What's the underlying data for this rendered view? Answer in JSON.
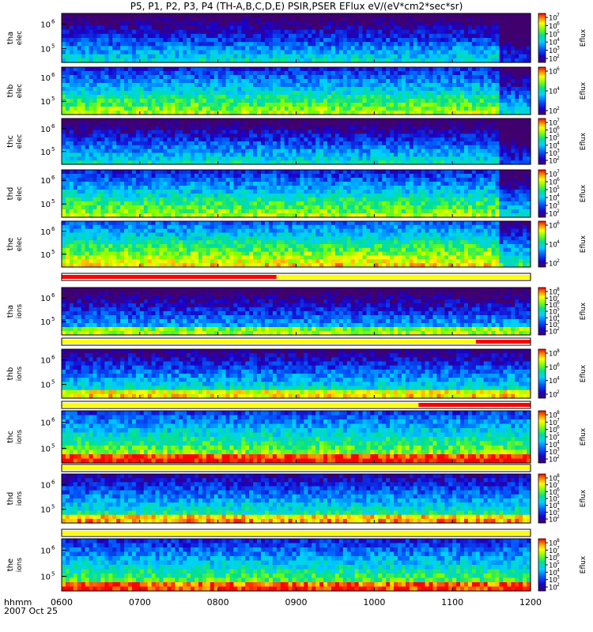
{
  "title": "P5, P1, P2, P3, P4 (TH-A,B,C,D,E) PSIR,PSER EFlux eV/(eV*cm2*sec*sr)",
  "time_axis": {
    "ticks": [
      "0600",
      "0700",
      "0800",
      "0900",
      "1000",
      "1100",
      "1200"
    ],
    "label_top": "hhmm",
    "label_bottom": "2007 Oct 25"
  },
  "colorbar_label": "Eflux",
  "chart_data": [
    {
      "type": "heatmap",
      "probe": "tha",
      "species": "elec",
      "ylabel_top": "tha",
      "ylabel_bottom": "elec",
      "y_ticks": [
        "10",
        "10"
      ],
      "y_tick_exp": [
        "6",
        "5"
      ],
      "cbar_ticks": [
        "10",
        "10",
        "10",
        "10",
        "10",
        "10"
      ],
      "cbar_exp": [
        "7",
        "6",
        "5",
        "4",
        "3",
        "2"
      ],
      "colormap": "rainbow",
      "level_fraction": 0.2
    },
    {
      "type": "heatmap",
      "probe": "thb",
      "species": "elec",
      "ylabel_top": "thb",
      "ylabel_bottom": "elec",
      "y_ticks": [
        "10",
        "10"
      ],
      "y_tick_exp": [
        "6",
        "5"
      ],
      "cbar_ticks": [
        "10",
        "10",
        "10"
      ],
      "cbar_exp": [
        "6",
        "4",
        "2"
      ],
      "colormap": "rainbow",
      "level_fraction": 0.45
    },
    {
      "type": "heatmap",
      "probe": "thc",
      "species": "elec",
      "ylabel_top": "thc",
      "ylabel_bottom": "elec",
      "y_ticks": [
        "10",
        "10"
      ],
      "y_tick_exp": [
        "6",
        "5"
      ],
      "cbar_ticks": [
        "10",
        "10",
        "10",
        "10",
        "10",
        "10"
      ],
      "cbar_exp": [
        "7",
        "6",
        "5",
        "4",
        "3",
        "2"
      ],
      "colormap": "rainbow",
      "level_fraction": 0.22
    },
    {
      "type": "heatmap",
      "probe": "thd",
      "species": "elec",
      "ylabel_top": "thd",
      "ylabel_bottom": "elec",
      "y_ticks": [
        "10",
        "10"
      ],
      "y_tick_exp": [
        "6",
        "5"
      ],
      "cbar_ticks": [
        "10",
        "10",
        "10",
        "10",
        "10",
        "10"
      ],
      "cbar_exp": [
        "7",
        "6",
        "5",
        "4",
        "3",
        "2"
      ],
      "colormap": "rainbow",
      "level_fraction": 0.45
    },
    {
      "type": "heatmap",
      "probe": "the",
      "species": "elec",
      "ylabel_top": "the",
      "ylabel_bottom": "elec",
      "y_ticks": [
        "10",
        "10"
      ],
      "y_tick_exp": [
        "6",
        "5"
      ],
      "cbar_ticks": [
        "10",
        "10",
        "10"
      ],
      "cbar_exp": [
        "6",
        "4",
        "2"
      ],
      "colormap": "rainbow",
      "level_fraction": 0.55
    },
    {
      "type": "heatmap",
      "probe": "tha",
      "species": "ions",
      "ylabel_top": "tha",
      "ylabel_bottom": "ions",
      "y_ticks": [
        "10",
        "10"
      ],
      "y_tick_exp": [
        "6",
        "5"
      ],
      "cbar_ticks": [
        "10",
        "10",
        "10",
        "10",
        "10",
        "10",
        "10"
      ],
      "cbar_exp": [
        "8",
        "7",
        "6",
        "5",
        "4",
        "3",
        "2"
      ],
      "colormap": "rainbow",
      "level_fraction": 0.2
    },
    {
      "type": "heatmap",
      "probe": "thb",
      "species": "ions",
      "ylabel_top": "thb",
      "ylabel_bottom": "ions",
      "y_ticks": [
        "10",
        "10"
      ],
      "y_tick_exp": [
        "6",
        "5"
      ],
      "cbar_ticks": [
        "10",
        "10",
        "10",
        "10"
      ],
      "cbar_exp": [
        "8",
        "6",
        "4",
        "2"
      ],
      "colormap": "rainbow",
      "level_fraction": 0.3
    },
    {
      "type": "heatmap",
      "probe": "thc",
      "species": "ions",
      "ylabel_top": "thc",
      "ylabel_bottom": "ions",
      "y_ticks": [
        "10",
        "10"
      ],
      "y_tick_exp": [
        "6",
        "5"
      ],
      "cbar_ticks": [
        "10",
        "10",
        "10",
        "10",
        "10",
        "10",
        "10"
      ],
      "cbar_exp": [
        "8",
        "7",
        "6",
        "5",
        "4",
        "3",
        "2"
      ],
      "colormap": "rainbow",
      "level_fraction": 0.5
    },
    {
      "type": "heatmap",
      "probe": "thd",
      "species": "ions",
      "ylabel_top": "thd",
      "ylabel_bottom": "ions",
      "y_ticks": [
        "10",
        "10"
      ],
      "y_tick_exp": [
        "6",
        "5"
      ],
      "cbar_ticks": [
        "10",
        "10",
        "10",
        "10",
        "10",
        "10",
        "10"
      ],
      "cbar_exp": [
        "8",
        "7",
        "6",
        "5",
        "4",
        "3",
        "2"
      ],
      "colormap": "rainbow",
      "level_fraction": 0.35
    },
    {
      "type": "heatmap",
      "probe": "the",
      "species": "ions",
      "ylabel_top": "the",
      "ylabel_bottom": "ions",
      "y_ticks": [
        "10",
        "10"
      ],
      "y_tick_exp": [
        "6",
        "5"
      ],
      "cbar_ticks": [
        "10",
        "10",
        "10",
        "10",
        "10",
        "10",
        "10"
      ],
      "cbar_exp": [
        "8",
        "7",
        "6",
        "5",
        "4",
        "3",
        "2"
      ],
      "colormap": "rainbow",
      "level_fraction": 0.45
    }
  ],
  "mode_bars": [
    {
      "after_panel": 4,
      "segments": [
        {
          "start": "0600",
          "end": "0845",
          "color": "#ff0000"
        },
        {
          "start": "0845",
          "end": "1200",
          "color": "#ffff00"
        }
      ]
    },
    {
      "after_panel": 5,
      "segments": [
        {
          "start": "0600",
          "end": "1118",
          "color": "#ffff00"
        },
        {
          "start": "1118",
          "end": "1200",
          "color": "#ff0000"
        }
      ]
    },
    {
      "after_panel": 6,
      "segments": [
        {
          "start": "0600",
          "end": "1034",
          "color": "#ffff00"
        },
        {
          "start": "1034",
          "end": "1200",
          "color": "#ff0000"
        }
      ]
    },
    {
      "after_panel": 7,
      "segments": [
        {
          "start": "0600",
          "end": "1200",
          "color": "#ffff00"
        }
      ]
    },
    {
      "after_panel": 8,
      "segments": [
        {
          "start": "0600",
          "end": "1200",
          "color": "#ffff00"
        }
      ]
    }
  ]
}
